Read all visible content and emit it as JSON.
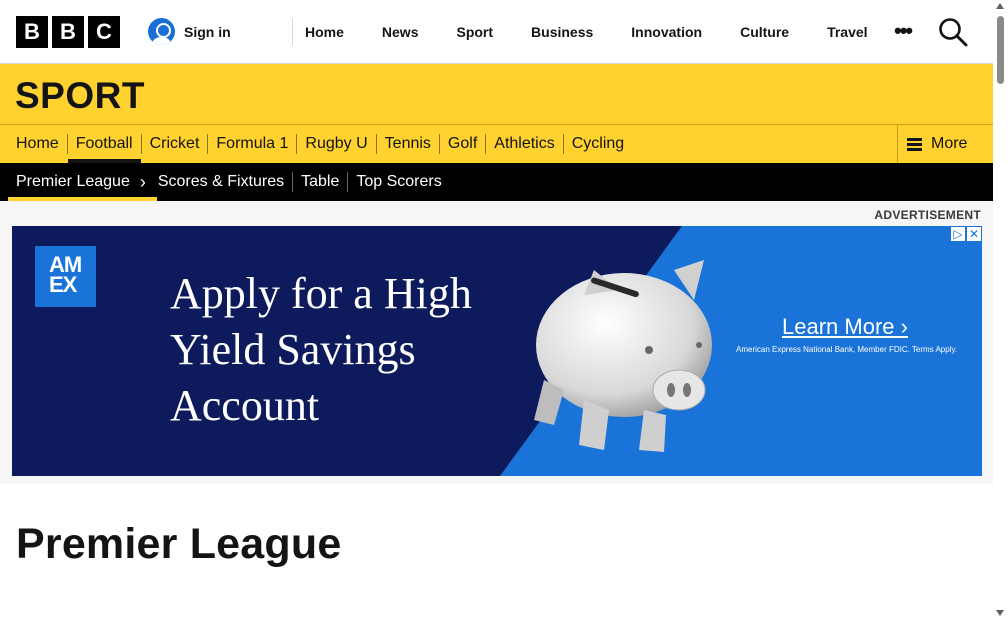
{
  "header": {
    "logo_letters": [
      "B",
      "B",
      "C"
    ],
    "signin_label": "Sign in",
    "nav": [
      "Home",
      "News",
      "Sport",
      "Business",
      "Innovation",
      "Culture",
      "Travel"
    ],
    "more_glyph": "•••",
    "search_icon": "search-icon"
  },
  "sport": {
    "title": "SPORT",
    "nav": [
      "Home",
      "Football",
      "Cricket",
      "Formula 1",
      "Rugby U",
      "Tennis",
      "Golf",
      "Athletics",
      "Cycling"
    ],
    "active_item": "Football",
    "more_label": "More"
  },
  "competition_nav": {
    "current": "Premier League",
    "items": [
      "Scores & Fixtures",
      "Table",
      "Top Scorers"
    ]
  },
  "advert": {
    "label": "ADVERTISEMENT",
    "brand": "AM EX",
    "headline": "Apply for a High Yield Savings Account",
    "cta": "Learn More ›",
    "disclaimer": "American Express National Bank, Member FDIC. Terms Apply.",
    "adchoices": [
      "▷",
      "✕"
    ]
  },
  "page": {
    "title": "Premier League"
  },
  "colors": {
    "sport_yellow": "#ffd230",
    "ad_navy": "#0d1a5c",
    "ad_blue": "#1a73d9",
    "signin_blue": "#1a6fd6"
  }
}
